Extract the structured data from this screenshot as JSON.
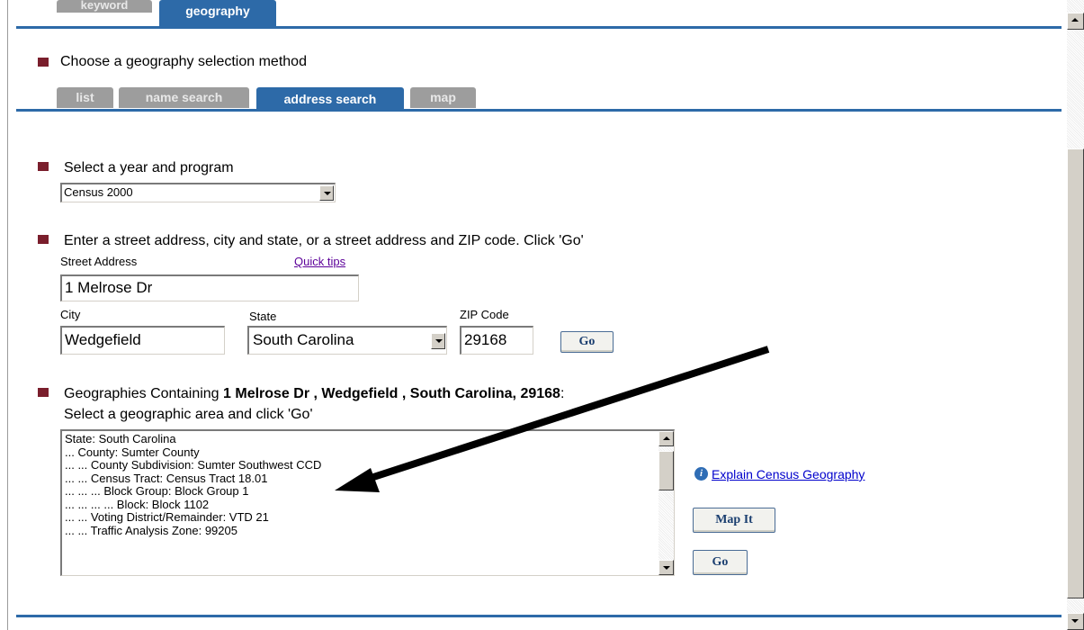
{
  "top_tabs": [
    {
      "label": "keyword",
      "active": false
    },
    {
      "label": "geography",
      "active": true
    }
  ],
  "selection_method": {
    "title": "Choose a geography selection method",
    "tabs": [
      {
        "label": "list",
        "active": false
      },
      {
        "label": "name search",
        "active": false
      },
      {
        "label": "address search",
        "active": true
      },
      {
        "label": "map",
        "active": false
      }
    ]
  },
  "year_program": {
    "title": "Select a year and program",
    "selected": "Census 2000"
  },
  "address": {
    "title": "Enter a street address, city and state, or a street address and ZIP code. Click 'Go'",
    "street_label": "Street Address",
    "quick_tips": "Quick tips",
    "street_value": "1 Melrose Dr",
    "city_label": "City",
    "city_value": "Wedgefield",
    "state_label": "State",
    "state_value": "South Carolina",
    "zip_label": "ZIP Code",
    "zip_value": "29168",
    "go_label": "Go"
  },
  "geographies": {
    "title_prefix": "Geographies Containing ",
    "title_bold": "1 Melrose Dr , Wedgefield , South Carolina, 29168",
    "title_suffix": ":",
    "instruction": "Select a geographic area and click 'Go'",
    "items": [
      "State: South Carolina",
      "... County: Sumter County",
      "... ... County Subdivision: Sumter Southwest CCD",
      "... ... Census Tract: Census Tract 18.01",
      "... ... ... Block Group: Block Group 1",
      "... ... ... ... Block: Block 1102",
      "... ... Voting District/Remainder: VTD 21",
      "... ... Traffic Analysis Zone: 99205"
    ],
    "explain_link": "Explain Census Geography",
    "map_it_label": "Map It",
    "go_label": "Go"
  },
  "colors": {
    "accent_blue": "#2d6aa8",
    "bullet": "#7a1e2c",
    "tab_inactive": "#9d9d9d",
    "arrow": "#000000"
  },
  "icons": [
    "info-icon",
    "arrow-annotation"
  ]
}
